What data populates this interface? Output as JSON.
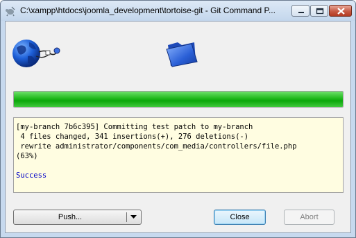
{
  "window": {
    "title": "C:\\xampp\\htdocs\\joomla_development\\tortoise-git - Git Command P...",
    "controls": {
      "minimize": "minimize",
      "maximize": "maximize",
      "close": "close"
    }
  },
  "icons": {
    "app": "tortoisegit-icon",
    "source": "globe-network-icon",
    "destination": "folder-icon"
  },
  "progress": {
    "value": 1.0,
    "color": "#1fb51b"
  },
  "log": {
    "lines": [
      "[my-branch 7b6c395] Committing test patch to my-branch",
      " 4 files changed, 341 insertions(+), 276 deletions(-)",
      " rewrite administrator/components/com_media/controllers/file.php",
      "(63%)"
    ],
    "status": "Success",
    "status_color": "#0000c8"
  },
  "buttons": {
    "push": "Push...",
    "close": "Close",
    "abort": "Abort"
  }
}
